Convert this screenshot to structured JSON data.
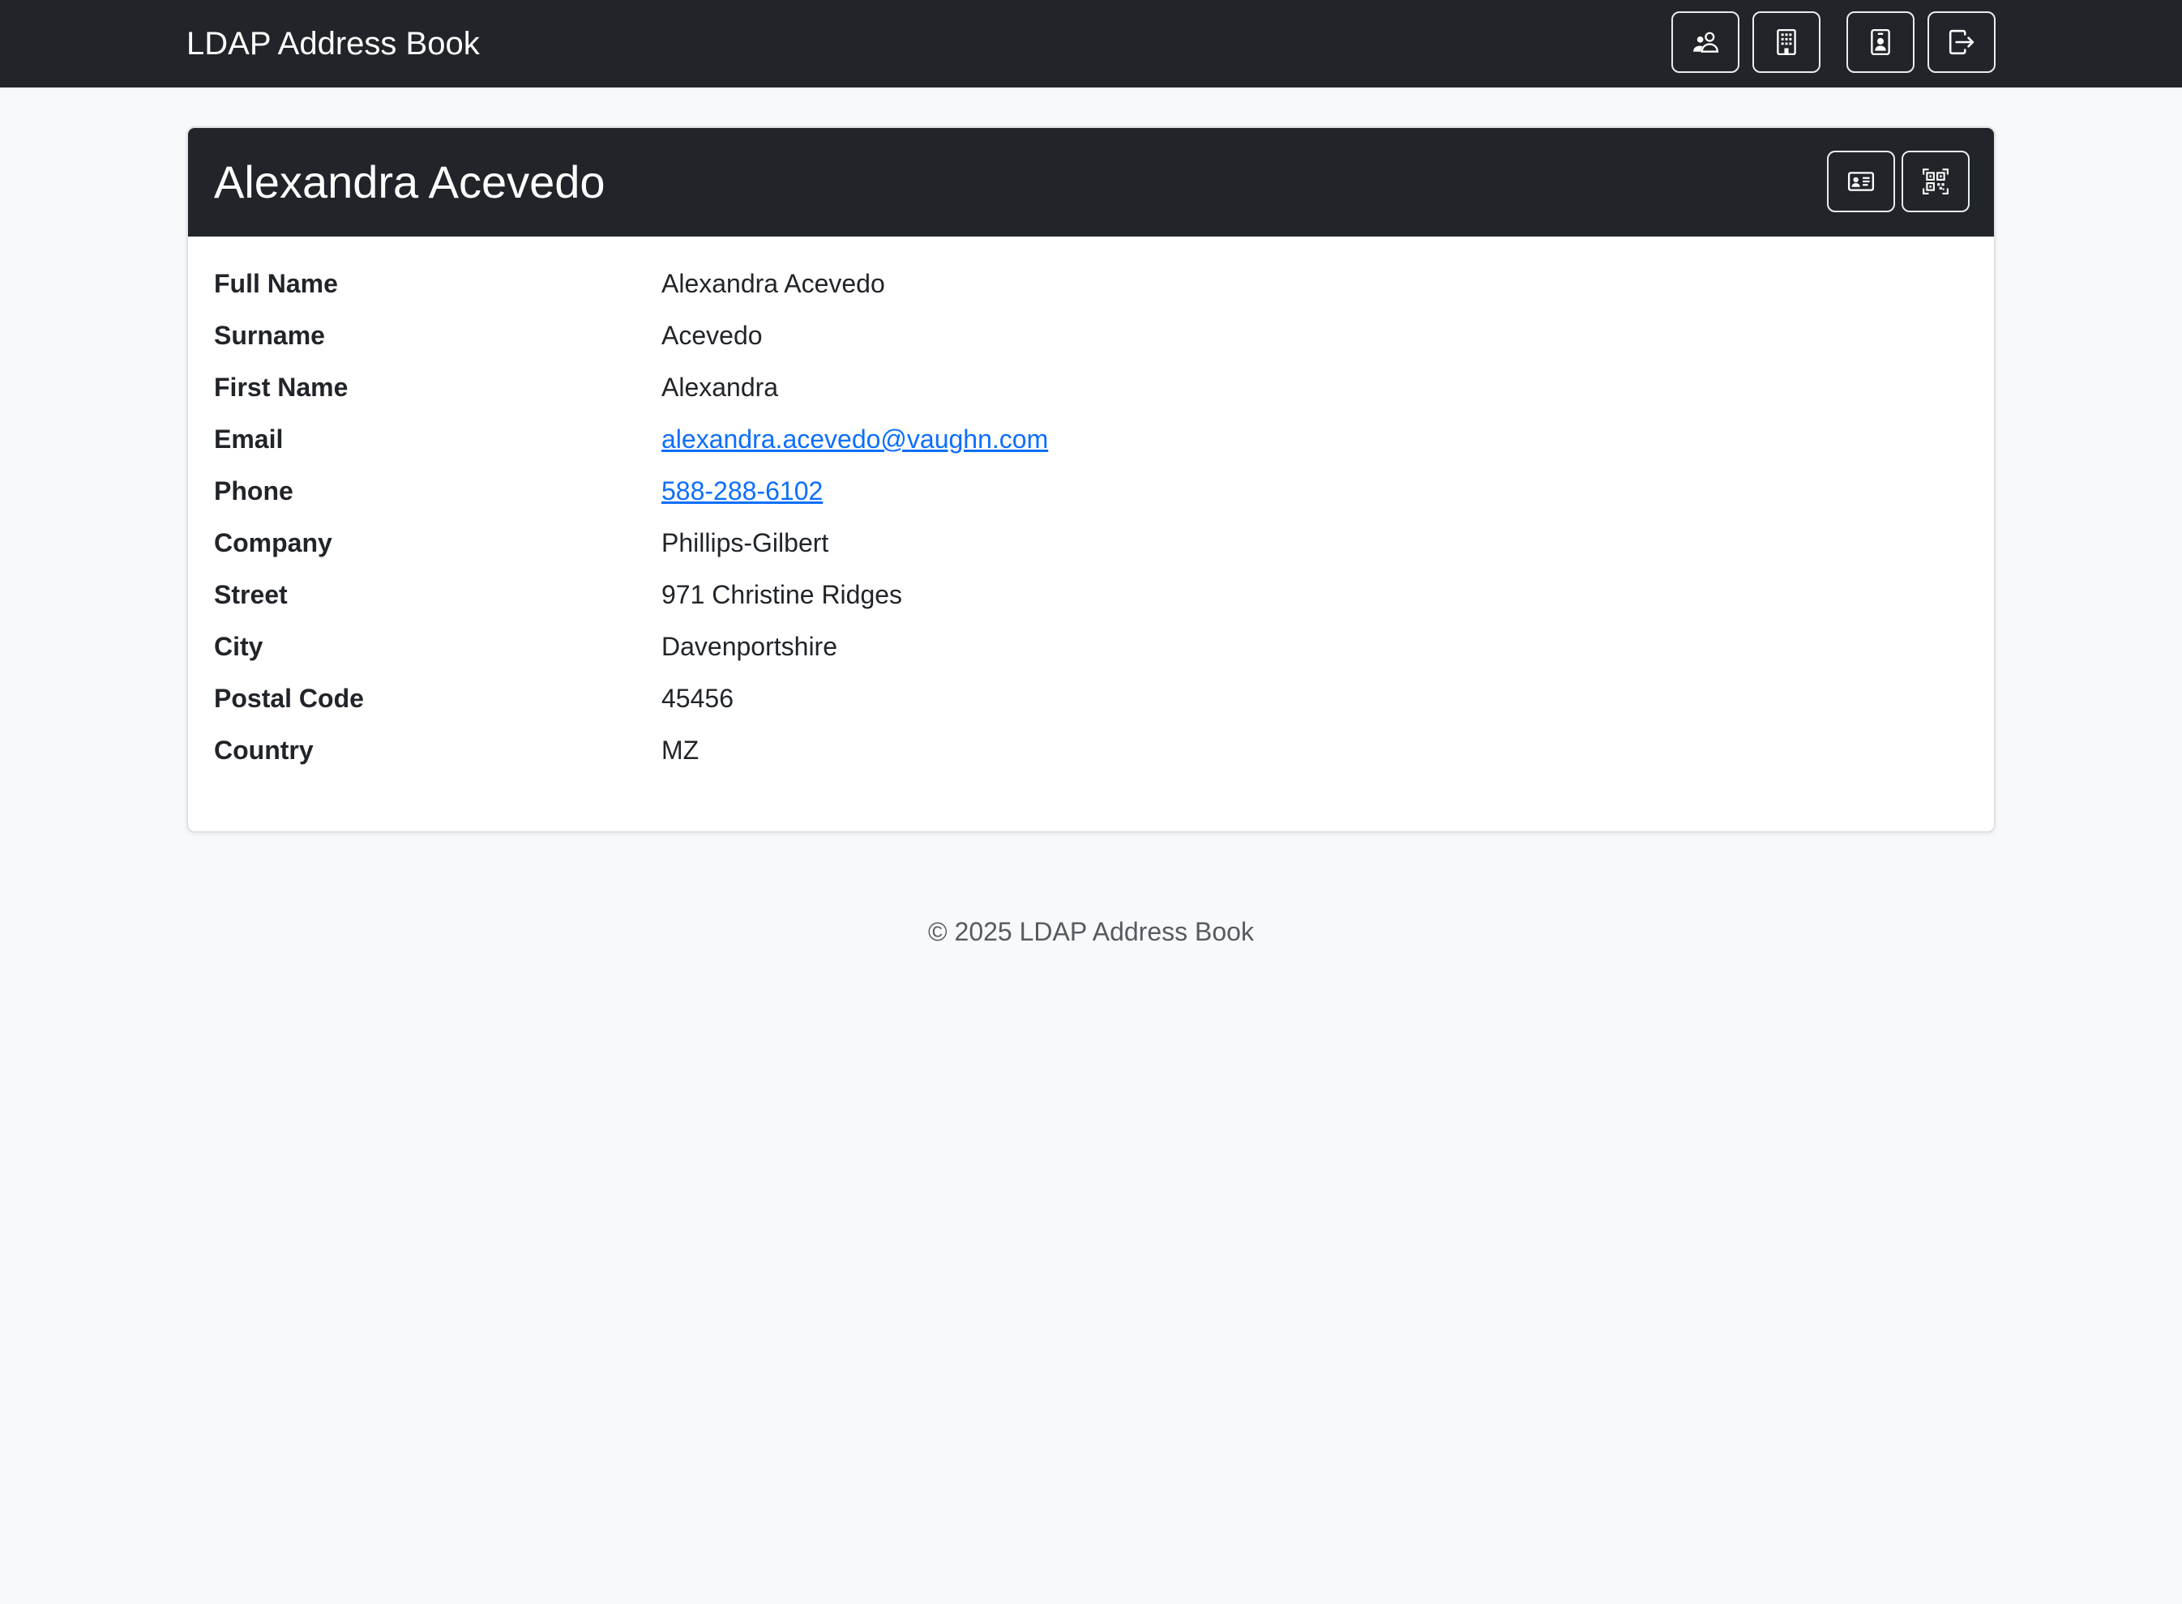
{
  "navbar": {
    "brand": "LDAP Address Book",
    "buttons": [
      {
        "icon": "people-icon"
      },
      {
        "icon": "building-icon"
      },
      {
        "icon": "person-badge-icon"
      },
      {
        "icon": "logout-icon"
      }
    ]
  },
  "contact": {
    "title": "Alexandra Acevedo",
    "header_buttons": [
      {
        "icon": "vcard-icon"
      },
      {
        "icon": "qr-code-icon"
      }
    ],
    "fields": [
      {
        "label": "Full Name",
        "value": "Alexandra Acevedo"
      },
      {
        "label": "Surname",
        "value": "Acevedo"
      },
      {
        "label": "First Name",
        "value": "Alexandra"
      },
      {
        "label": "Email",
        "value": "alexandra.acevedo@vaughn.com"
      },
      {
        "label": "Phone",
        "value": "588-288-6102"
      },
      {
        "label": "Company",
        "value": "Phillips-Gilbert"
      },
      {
        "label": "Street",
        "value": "971 Christine Ridges"
      },
      {
        "label": "City",
        "value": "Davenportshire"
      },
      {
        "label": "Postal Code",
        "value": "45456"
      },
      {
        "label": "Country",
        "value": "MZ"
      }
    ]
  },
  "footer": {
    "text": "© 2025 LDAP Address Book"
  },
  "colors": {
    "navbar_bg": "#212529",
    "page_bg": "#f8f9fa",
    "link": "#0d6efd"
  }
}
